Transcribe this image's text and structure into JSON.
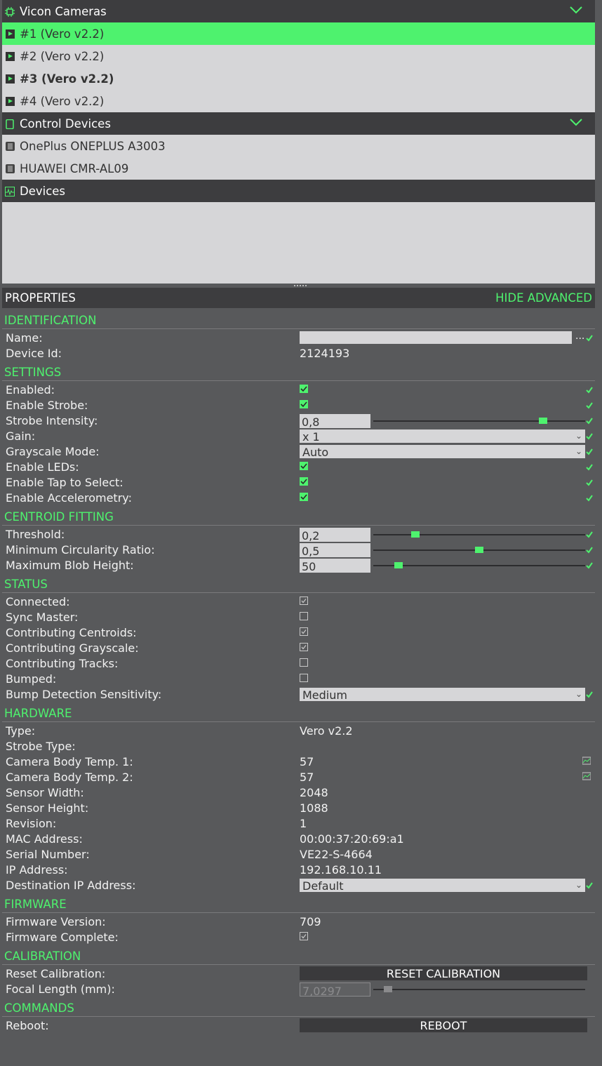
{
  "tree": {
    "groups": [
      {
        "title": "Vicon Cameras",
        "items": [
          "#1 (Vero v2.2)",
          "#2 (Vero v2.2)",
          "#3 (Vero v2.2)",
          "#4 (Vero v2.2)"
        ]
      },
      {
        "title": "Control Devices",
        "items": [
          "OnePlus ONEPLUS A3003",
          "HUAWEI CMR-AL09"
        ]
      },
      {
        "title": "Devices",
        "items": []
      }
    ]
  },
  "properties": {
    "title": "PROPERTIES",
    "hide_advanced": "HIDE ADVANCED",
    "sections": {
      "identification": "IDENTIFICATION",
      "settings": "SETTINGS",
      "centroid": "CENTROID FITTING",
      "status": "STATUS",
      "hardware": "HARDWARE",
      "firmware": "FIRMWARE",
      "calibration": "CALIBRATION",
      "commands": "COMMANDS"
    },
    "labels": {
      "name": "Name:",
      "device_id": "Device Id:",
      "enabled": "Enabled:",
      "enable_strobe": "Enable Strobe:",
      "strobe_intensity": "Strobe Intensity:",
      "gain": "Gain:",
      "grayscale_mode": "Grayscale Mode:",
      "enable_leds": "Enable LEDs:",
      "enable_tap": "Enable Tap to Select:",
      "enable_accel": "Enable Accelerometry:",
      "threshold": "Threshold:",
      "min_circ": "Minimum Circularity Ratio:",
      "max_blob": "Maximum Blob Height:",
      "connected": "Connected:",
      "sync_master": "Sync Master:",
      "contrib_centroids": "Contributing Centroids:",
      "contrib_grayscale": "Contributing Grayscale:",
      "contrib_tracks": "Contributing Tracks:",
      "bumped": "Bumped:",
      "bump_sens": "Bump Detection Sensitivity:",
      "type": "Type:",
      "strobe_type": "Strobe Type:",
      "temp1": "Camera Body Temp. 1:",
      "temp2": "Camera Body Temp. 2:",
      "sensor_width": "Sensor Width:",
      "sensor_height": "Sensor Height:",
      "revision": "Revision:",
      "mac": "MAC Address:",
      "serial": "Serial Number:",
      "ip": "IP Address:",
      "dest_ip": "Destination IP Address:",
      "fw_version": "Firmware Version:",
      "fw_complete": "Firmware Complete:",
      "reset_cal": "Reset Calibration:",
      "focal": "Focal Length (mm):",
      "reboot": "Reboot:"
    },
    "values": {
      "device_id": "2124193",
      "strobe_intensity": "0,8",
      "gain": "x 1",
      "grayscale_mode": "Auto",
      "threshold": "0,2",
      "min_circ": "0,5",
      "max_blob": "50",
      "bump_sens": "Medium",
      "type": "Vero v2.2",
      "temp1": "57",
      "temp2": "57",
      "sensor_width": "2048",
      "sensor_height": "1088",
      "revision": "1",
      "mac": "00:00:37:20:69:a1",
      "serial": "VE22-S-4664",
      "ip": "192.168.10.11",
      "dest_ip": "Default",
      "fw_version": "709",
      "focal": "7,0297",
      "reset_btn": "RESET CALIBRATION",
      "reboot_btn": "REBOOT",
      "ellipsis": "..."
    },
    "sliders": {
      "strobe_intensity": 0.8,
      "threshold": 0.2,
      "min_circ": 0.5,
      "max_blob_fraction": 0.12,
      "focal_fraction": 0.07
    }
  },
  "colors": {
    "accent": "#4ef26e",
    "panel": "#58595b",
    "header": "#3d3d3f",
    "list": "#d6d6d8"
  }
}
